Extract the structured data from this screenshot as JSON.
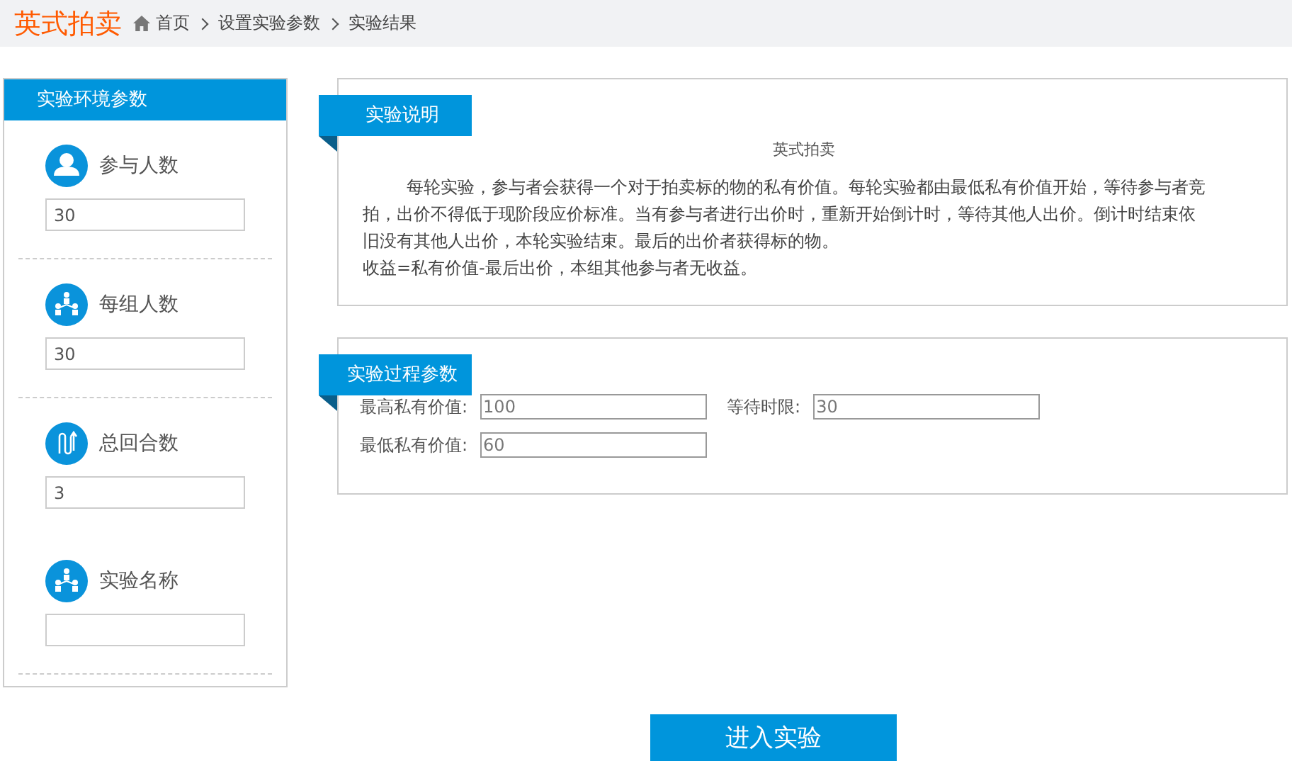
{
  "header": {
    "title": "英式拍卖",
    "breadcrumb": [
      {
        "label": "首页"
      },
      {
        "label": "设置实验参数"
      },
      {
        "label": "实验结果"
      }
    ]
  },
  "sidebar": {
    "title": "实验环境参数",
    "params": [
      {
        "label": "参与人数",
        "kind": "person",
        "value": "30"
      },
      {
        "label": "每组人数",
        "kind": "group",
        "value": "30"
      },
      {
        "label": "总回合数",
        "kind": "clip",
        "value": "3"
      },
      {
        "label": "实验名称",
        "kind": "group"
      }
    ]
  },
  "description": {
    "title": "实验说明",
    "subtitle": "英式拍卖",
    "paragraphs": [
      {
        "text": "每轮实验，参与者会获得一个对于拍卖标的物的私有价值。每轮实验都由最低私有价值开始，等待参与者竞拍，出价不得低于现阶段应价标准。当有参与者进行出价时，重新开始倒计时，等待其他人出价。倒计时结束依旧没有其他人出价，本轮实验结束。最后的出价者获得标的物。",
        "indent": true
      },
      {
        "text": "收益=私有价值-最后出价，本组其他参与者无收益。",
        "indent": false
      }
    ]
  },
  "process": {
    "title": "实验过程参数",
    "rows": [
      [
        {
          "label": "最高私有价值:",
          "value": "100"
        },
        {
          "label": "等待时限:",
          "value": "30"
        }
      ],
      [
        {
          "label": "最低私有价值:",
          "value": "60"
        }
      ]
    ]
  },
  "enter_button": "进入实验"
}
